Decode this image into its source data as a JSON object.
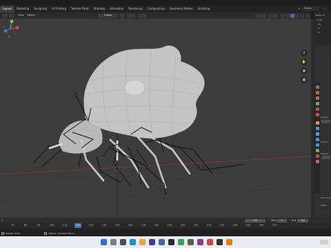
{
  "workspace_tabs": [
    "Layout",
    "Modeling",
    "Sculpting",
    "UV Editing",
    "Texture Paint",
    "Shading",
    "Animation",
    "Rendering",
    "Compositing",
    "Geometry Nodes",
    "Scripting"
  ],
  "active_tab_index": 0,
  "scene_name": "Scene",
  "viewport_header": {
    "menus": [
      "View",
      "Object"
    ],
    "transform_orientation": "Global",
    "options_label": "Options"
  },
  "outliner": {
    "rows": [
      "Scene Co",
      "Colle",
      "Ca",
      "Ar",
      "Ic"
    ]
  },
  "properties": {
    "labels": [
      "Subsurf",
      "Subsurf",
      "Subsurf",
      "Color Spa",
      "Alpha"
    ]
  },
  "timeline": {
    "start_label": "Start",
    "start_value": "1",
    "end_label": "End",
    "end_value": "250",
    "current_frame": "120",
    "ticks": [
      "70",
      "80",
      "90",
      "100",
      "110",
      "120",
      "130",
      "140",
      "150",
      "160",
      "170",
      "180",
      "190",
      "200",
      "210",
      "220",
      "230",
      "240",
      "250",
      "260",
      "270"
    ]
  },
  "statusbar": {
    "left_label": "Rotate View",
    "mid_label": "Object Context Menu"
  },
  "colors": {
    "accent": "#4772b3",
    "viewport_bg": "#3c3c3c",
    "mesh": "#c4c4c4"
  }
}
